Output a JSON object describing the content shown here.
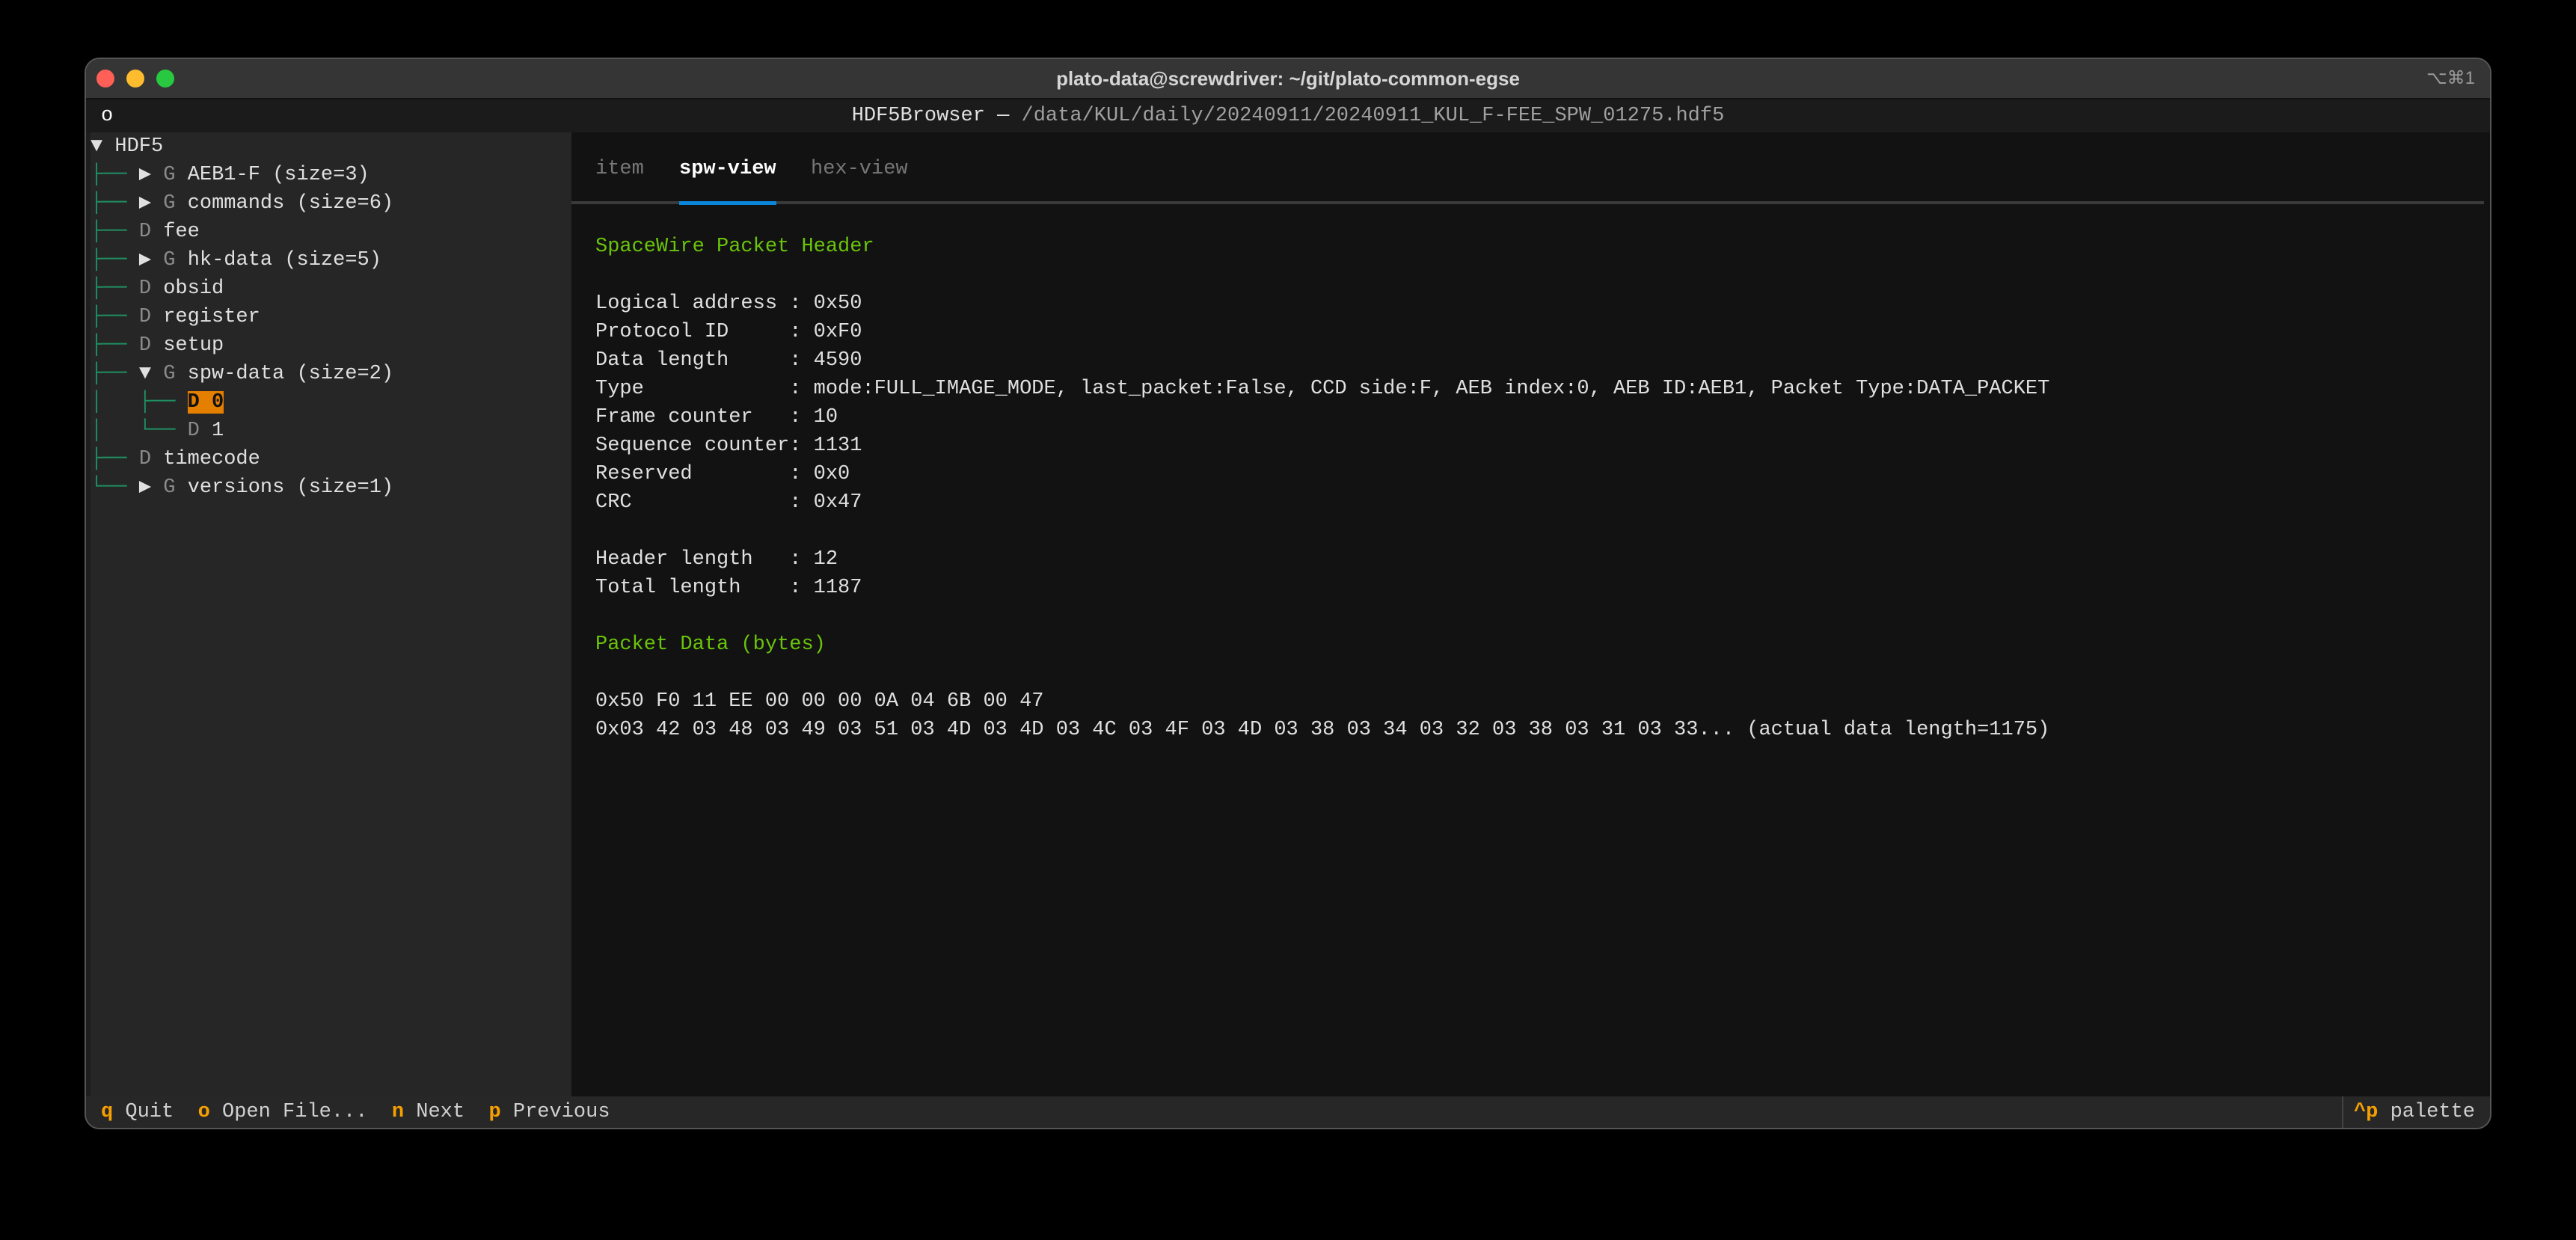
{
  "window": {
    "title": "plato-data@screwdriver: ~/git/plato-common-egse",
    "shortcut": "⌥⌘1"
  },
  "header": {
    "app": "HDF5Browser",
    "sep": " — ",
    "path": "/data/KUL/daily/20240911/20240911_KUL_F-FEE_SPW_01275.hdf5",
    "indicator": "o"
  },
  "tree": {
    "root": "HDF5",
    "items": [
      {
        "prefix": "├── ",
        "arrow": "▶ ",
        "kind": "G",
        "label": "AEB1-F (size=3)"
      },
      {
        "prefix": "├── ",
        "arrow": "▶ ",
        "kind": "G",
        "label": "commands (size=6)"
      },
      {
        "prefix": "├── ",
        "arrow": "",
        "kind": "D",
        "label": "fee"
      },
      {
        "prefix": "├── ",
        "arrow": "▶ ",
        "kind": "G",
        "label": "hk-data (size=5)"
      },
      {
        "prefix": "├── ",
        "arrow": "",
        "kind": "D",
        "label": "obsid"
      },
      {
        "prefix": "├── ",
        "arrow": "",
        "kind": "D",
        "label": "register"
      },
      {
        "prefix": "├── ",
        "arrow": "",
        "kind": "D",
        "label": "setup"
      },
      {
        "prefix": "├── ",
        "arrow": "▼ ",
        "kind": "G",
        "label": "spw-data (size=2)"
      },
      {
        "prefix": "│   ├── ",
        "arrow": "",
        "kind": "D",
        "label": "0",
        "selected": true
      },
      {
        "prefix": "│   └── ",
        "arrow": "",
        "kind": "D",
        "label": "1"
      },
      {
        "prefix": "├── ",
        "arrow": "",
        "kind": "D",
        "label": "timecode"
      },
      {
        "prefix": "└── ",
        "arrow": "▶ ",
        "kind": "G",
        "label": "versions (size=1)"
      }
    ]
  },
  "tabs": [
    {
      "label": "item"
    },
    {
      "label": "spw-view",
      "active": true
    },
    {
      "label": "hex-view"
    }
  ],
  "content": {
    "header_title": "SpaceWire Packet Header",
    "fields": [
      "Logical address : 0x50",
      "Protocol ID     : 0xF0",
      "Data length     : 4590",
      "Type            : mode:FULL_IMAGE_MODE, last_packet:False, CCD side:F, AEB index:0, AEB ID:AEB1, Packet Type:DATA_PACKET",
      "Frame counter   : 10",
      "Sequence counter: 1131",
      "Reserved        : 0x0",
      "CRC             : 0x47"
    ],
    "lengths": [
      "Header length   : 12",
      "Total length    : 1187"
    ],
    "data_title": "Packet Data (bytes)",
    "data_lines": [
      "0x50 F0 11 EE 00 00 00 0A 04 6B 00 47",
      "0x03 42 03 48 03 49 03 51 03 4D 03 4D 03 4C 03 4F 03 4D 03 38 03 34 03 32 03 38 03 31 03 33... (actual data length=1175)"
    ]
  },
  "footer": {
    "bindings": [
      {
        "key": "q",
        "label": "Quit"
      },
      {
        "key": "o",
        "label": "Open File..."
      },
      {
        "key": "n",
        "label": "Next"
      },
      {
        "key": "p",
        "label": "Previous"
      }
    ],
    "palette": {
      "key": "^p",
      "label": "palette"
    }
  },
  "colors": {
    "accent": "#0a85d9",
    "selection": "#e57f00",
    "heading": "#6ac40a",
    "key": "#f5a000",
    "tree_line": "#1f8f63"
  }
}
